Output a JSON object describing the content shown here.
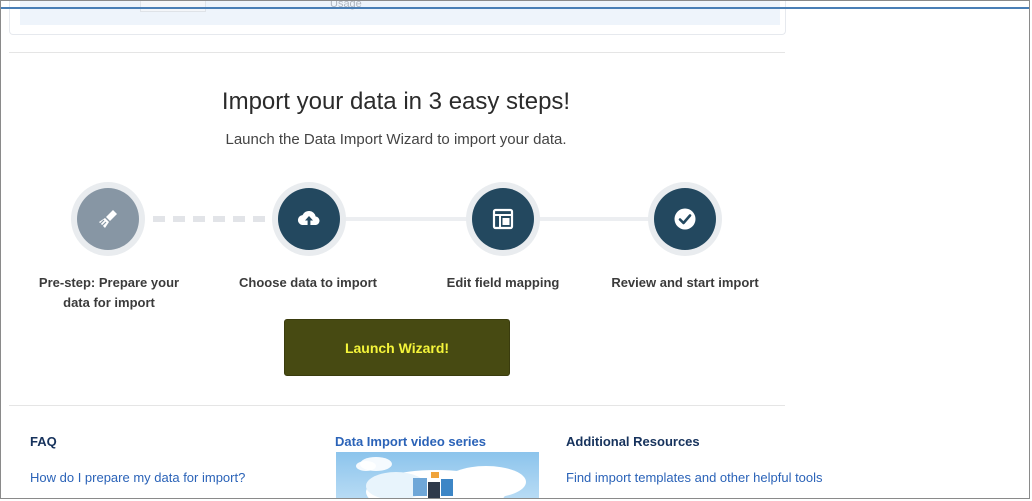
{
  "header": {
    "clipped_text": "Usage"
  },
  "hero": {
    "title": "Import your data in 3 easy steps!",
    "subtitle": "Launch the Data Import Wizard to import your data."
  },
  "steps": [
    {
      "label": "Pre-step: Prepare your data for import",
      "icon": "broom-icon",
      "state": "inactive"
    },
    {
      "label": "Choose data to import",
      "icon": "cloud-upload-icon",
      "state": "active"
    },
    {
      "label": "Edit field mapping",
      "icon": "layout-icon",
      "state": "active"
    },
    {
      "label": "Review and start import",
      "icon": "check-circle-icon",
      "state": "active"
    }
  ],
  "launch": {
    "label": "Launch Wizard!"
  },
  "resources": {
    "faq": {
      "heading": "FAQ",
      "link": "How do I prepare my data for import?"
    },
    "video": {
      "heading": "Data Import video series"
    },
    "additional": {
      "heading": "Additional Resources",
      "link": "Find import templates and other helpful tools"
    }
  },
  "colors": {
    "step_active": "#23485f",
    "step_inactive": "#8796a4",
    "launch_bg": "#474a12",
    "launch_text": "#f5f53a",
    "heading_navy": "#16325c",
    "link_blue": "#2b63b8"
  }
}
